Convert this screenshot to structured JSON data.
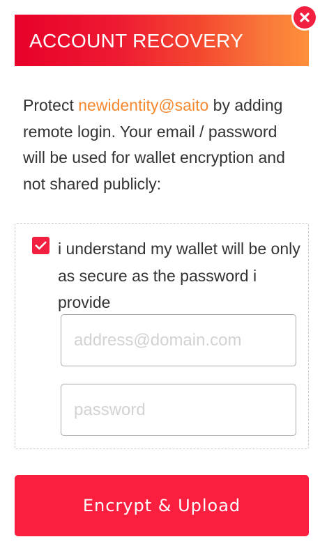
{
  "header": {
    "title": "ACCOUNT RECOVERY"
  },
  "close_button": {
    "icon": "close-icon",
    "glyph": "×"
  },
  "intro": {
    "prefix": "Protect ",
    "identity": "newidentity@saito",
    "suffix": " by adding remote login. Your email / password will be used for wallet encryption and not shared publicly:"
  },
  "consent": {
    "checked": true,
    "label": "i understand my wallet will be only as secure as the password i provide"
  },
  "form": {
    "email_placeholder": "address@domain.com",
    "email_value": "",
    "password_placeholder": "password",
    "password_value": ""
  },
  "submit": {
    "label": "Encrypt & Upload"
  },
  "colors": {
    "accent": "#fb1f3f",
    "identity_highlight": "#f5882f",
    "header_gradient_start": "#e8002a",
    "header_gradient_end": "#ff8f3a"
  }
}
